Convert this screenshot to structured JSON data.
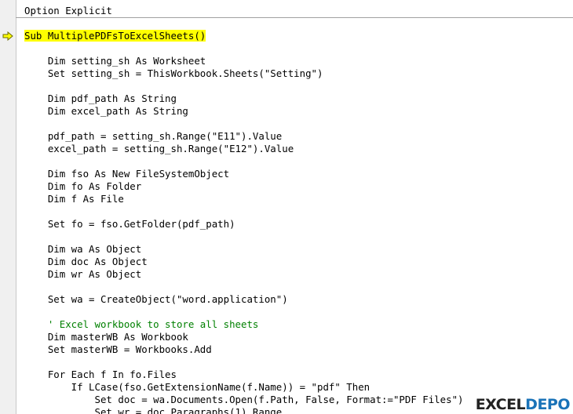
{
  "editor": {
    "lines": [
      {
        "text": "Option Explicit",
        "type": "code"
      },
      {
        "text": "",
        "type": "code"
      },
      {
        "text": "Sub MultiplePDFsToExcelSheets()",
        "type": "current"
      },
      {
        "text": "",
        "type": "code"
      },
      {
        "text": "    Dim setting_sh As Worksheet",
        "type": "code"
      },
      {
        "text": "    Set setting_sh = ThisWorkbook.Sheets(\"Setting\")",
        "type": "code"
      },
      {
        "text": "",
        "type": "code"
      },
      {
        "text": "    Dim pdf_path As String",
        "type": "code"
      },
      {
        "text": "    Dim excel_path As String",
        "type": "code"
      },
      {
        "text": "",
        "type": "code"
      },
      {
        "text": "    pdf_path = setting_sh.Range(\"E11\").Value",
        "type": "code"
      },
      {
        "text": "    excel_path = setting_sh.Range(\"E12\").Value",
        "type": "code"
      },
      {
        "text": "",
        "type": "code"
      },
      {
        "text": "    Dim fso As New FileSystemObject",
        "type": "code"
      },
      {
        "text": "    Dim fo As Folder",
        "type": "code"
      },
      {
        "text": "    Dim f As File",
        "type": "code"
      },
      {
        "text": "",
        "type": "code"
      },
      {
        "text": "    Set fo = fso.GetFolder(pdf_path)",
        "type": "code"
      },
      {
        "text": "",
        "type": "code"
      },
      {
        "text": "    Dim wa As Object",
        "type": "code"
      },
      {
        "text": "    Dim doc As Object",
        "type": "code"
      },
      {
        "text": "    Dim wr As Object",
        "type": "code"
      },
      {
        "text": "",
        "type": "code"
      },
      {
        "text": "    Set wa = CreateObject(\"word.application\")",
        "type": "code"
      },
      {
        "text": "",
        "type": "code"
      },
      {
        "text": "    ' Excel workbook to store all sheets",
        "type": "comment"
      },
      {
        "text": "    Dim masterWB As Workbook",
        "type": "code"
      },
      {
        "text": "    Set masterWB = Workbooks.Add",
        "type": "code"
      },
      {
        "text": "",
        "type": "code"
      },
      {
        "text": "    For Each f In fo.Files",
        "type": "code"
      },
      {
        "text": "        If LCase(fso.GetExtensionName(f.Name)) = \"pdf\" Then",
        "type": "code"
      },
      {
        "text": "            Set doc = wa.Documents.Open(f.Path, False, Format:=\"PDF Files\")",
        "type": "code"
      },
      {
        "text": "            Set wr = doc.Paragraphs(1).Range",
        "type": "code"
      }
    ]
  },
  "watermark": {
    "part1": "EXCEL",
    "part2": "DEPO"
  },
  "colors": {
    "highlight": "#ffff00",
    "arrow": "#ffff00",
    "comment": "#008000",
    "gutter": "#f0f0f0"
  },
  "icons": {
    "current_line": "arrow-right-icon"
  }
}
